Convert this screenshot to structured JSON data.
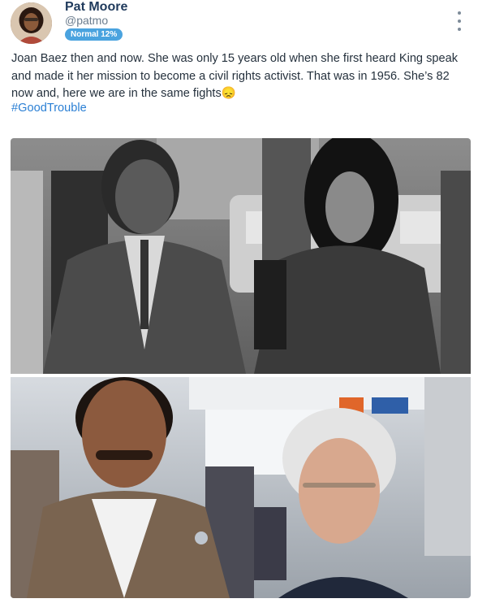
{
  "author": {
    "display_name": "Pat Moore",
    "handle": "@patmo",
    "badge": "Normal 12%",
    "avatar_icon": "user-avatar"
  },
  "post": {
    "text": "Joan Baez then and now. She was only 15 years old when she first heard King speak and made it her mission to become a civil rights activist. That was in 1956. She’s 82 now and, here we are in the same fights😞",
    "hashtag": "#GoodTrouble"
  },
  "menu": {
    "icon": "more-vertical-icon"
  },
  "media": {
    "top_photo": {
      "style": "black-and-white"
    },
    "bottom_photo": {
      "style": "color"
    }
  },
  "colors": {
    "name": "#1f3a5c",
    "handle": "#6b7c8d",
    "badge": "#4aa3df",
    "hashtag": "#2a7fd4"
  }
}
